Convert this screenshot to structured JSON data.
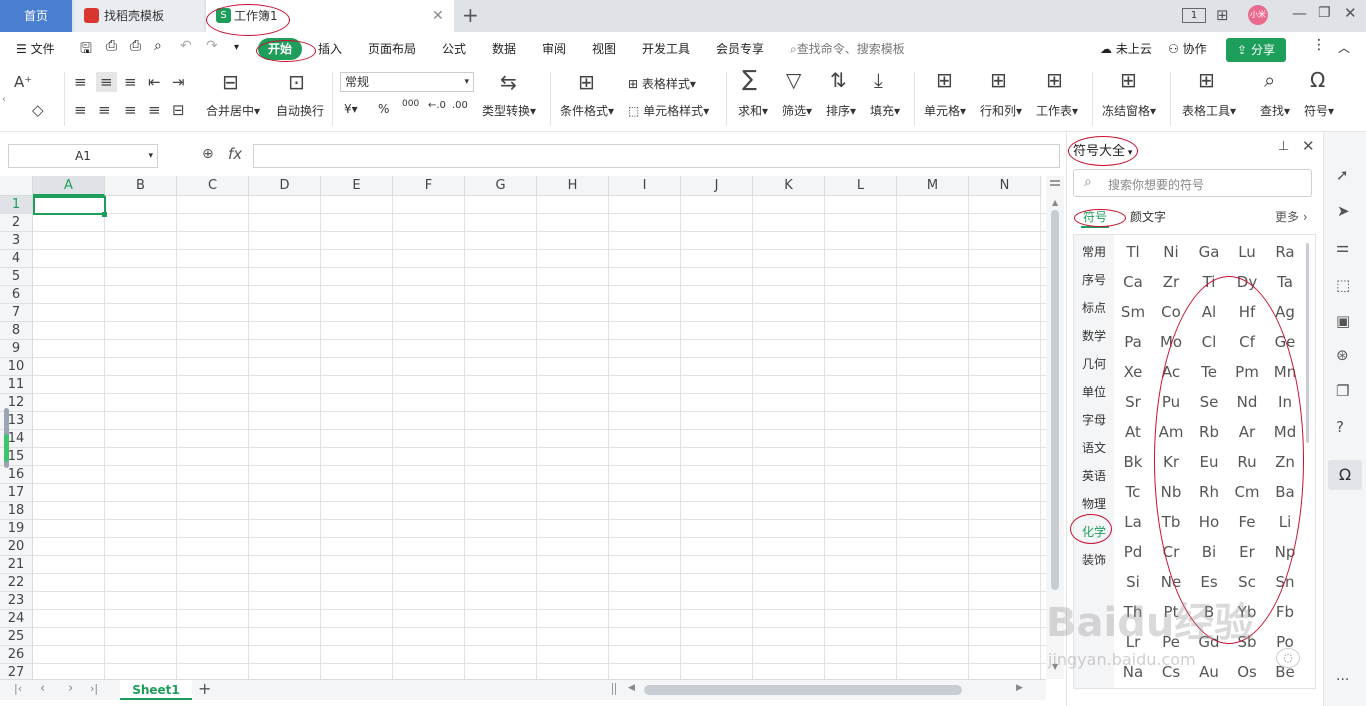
{
  "titlebar": {
    "tabs": [
      {
        "label": "首页"
      },
      {
        "label": "找稻壳模板"
      },
      {
        "label": "工作簿1"
      }
    ],
    "badge": "1",
    "avatar": "小米"
  },
  "menubar": {
    "file": "文件",
    "tabs": [
      "开始",
      "插入",
      "页面布局",
      "公式",
      "数据",
      "审阅",
      "视图",
      "开发工具",
      "会员专享"
    ],
    "search_placeholder": "查找命令、搜索模板",
    "cloud": "未上云",
    "collab": "协作",
    "share": "分享"
  },
  "toolbar": {
    "merge": "合并居中",
    "wrap": "自动换行",
    "format": "常规",
    "type_convert": "类型转换",
    "cond_format": "条件格式",
    "table_style": "表格样式",
    "cell_style": "单元格样式",
    "sum": "求和",
    "filter": "筛选",
    "sort": "排序",
    "fill": "填充",
    "cell": "单元格",
    "rowcol": "行和列",
    "sheet": "工作表",
    "freeze": "冻结窗格",
    "table_tools": "表格工具",
    "find": "查找",
    "symbol": "符号",
    "currency": "¥",
    "percent": "%",
    "thousands": "000"
  },
  "formula": {
    "cell_ref": "A1",
    "fx": "fx"
  },
  "grid": {
    "columns": [
      "A",
      "B",
      "C",
      "D",
      "E",
      "F",
      "G",
      "H",
      "I",
      "J",
      "K",
      "L",
      "M",
      "N"
    ],
    "rows": [
      "1",
      "2",
      "3",
      "4",
      "5",
      "6",
      "7",
      "8",
      "9",
      "10",
      "11",
      "12",
      "13",
      "14",
      "15",
      "16",
      "17",
      "18",
      "19",
      "20",
      "21",
      "22",
      "23",
      "24",
      "25",
      "26",
      "27"
    ]
  },
  "sheets": {
    "active": "Sheet1"
  },
  "panel": {
    "title": "符号大全",
    "search_placeholder": "搜索你想要的符号",
    "tabs": [
      "符号",
      "颜文字"
    ],
    "more": "更多",
    "categories": [
      "常用",
      "序号",
      "标点",
      "数学",
      "几何",
      "单位",
      "字母",
      "语文",
      "英语",
      "物理",
      "化学",
      "装饰"
    ],
    "symbols": [
      [
        "Tl",
        "Ni",
        "Ga",
        "Lu",
        "Ra"
      ],
      [
        "Ca",
        "Zr",
        "Ti",
        "Dy",
        "Ta"
      ],
      [
        "Sm",
        "Co",
        "Al",
        "Hf",
        "Ag"
      ],
      [
        "Pa",
        "Mo",
        "Cl",
        "Cf",
        "Ge"
      ],
      [
        "Xe",
        "Ac",
        "Te",
        "Pm",
        "Mn"
      ],
      [
        "Sr",
        "Pu",
        "Se",
        "Nd",
        "In"
      ],
      [
        "At",
        "Am",
        "Rb",
        "Ar",
        "Md"
      ],
      [
        "Bk",
        "Kr",
        "Eu",
        "Ru",
        "Zn"
      ],
      [
        "Tc",
        "Nb",
        "Rh",
        "Cm",
        "Ba"
      ],
      [
        "La",
        "Tb",
        "Ho",
        "Fe",
        "Li"
      ],
      [
        "Pd",
        "Cr",
        "Bi",
        "Er",
        "Np"
      ],
      [
        "Si",
        "Ne",
        "Es",
        "Sc",
        "Sn"
      ],
      [
        "Th",
        "Pt",
        "B",
        "Yb",
        "Fb"
      ],
      [
        "Lr",
        "Pe",
        "Gd",
        "Sb",
        "Po"
      ],
      [
        "Na",
        "Cs",
        "Au",
        "Os",
        "Be"
      ]
    ]
  },
  "watermark": {
    "brand": "Baidu经验",
    "url": "jingyan.baidu.com"
  },
  "colors": {
    "accent": "#1e9e5b",
    "home_tab": "#4a7fd0",
    "annotation": "#c8102e"
  }
}
